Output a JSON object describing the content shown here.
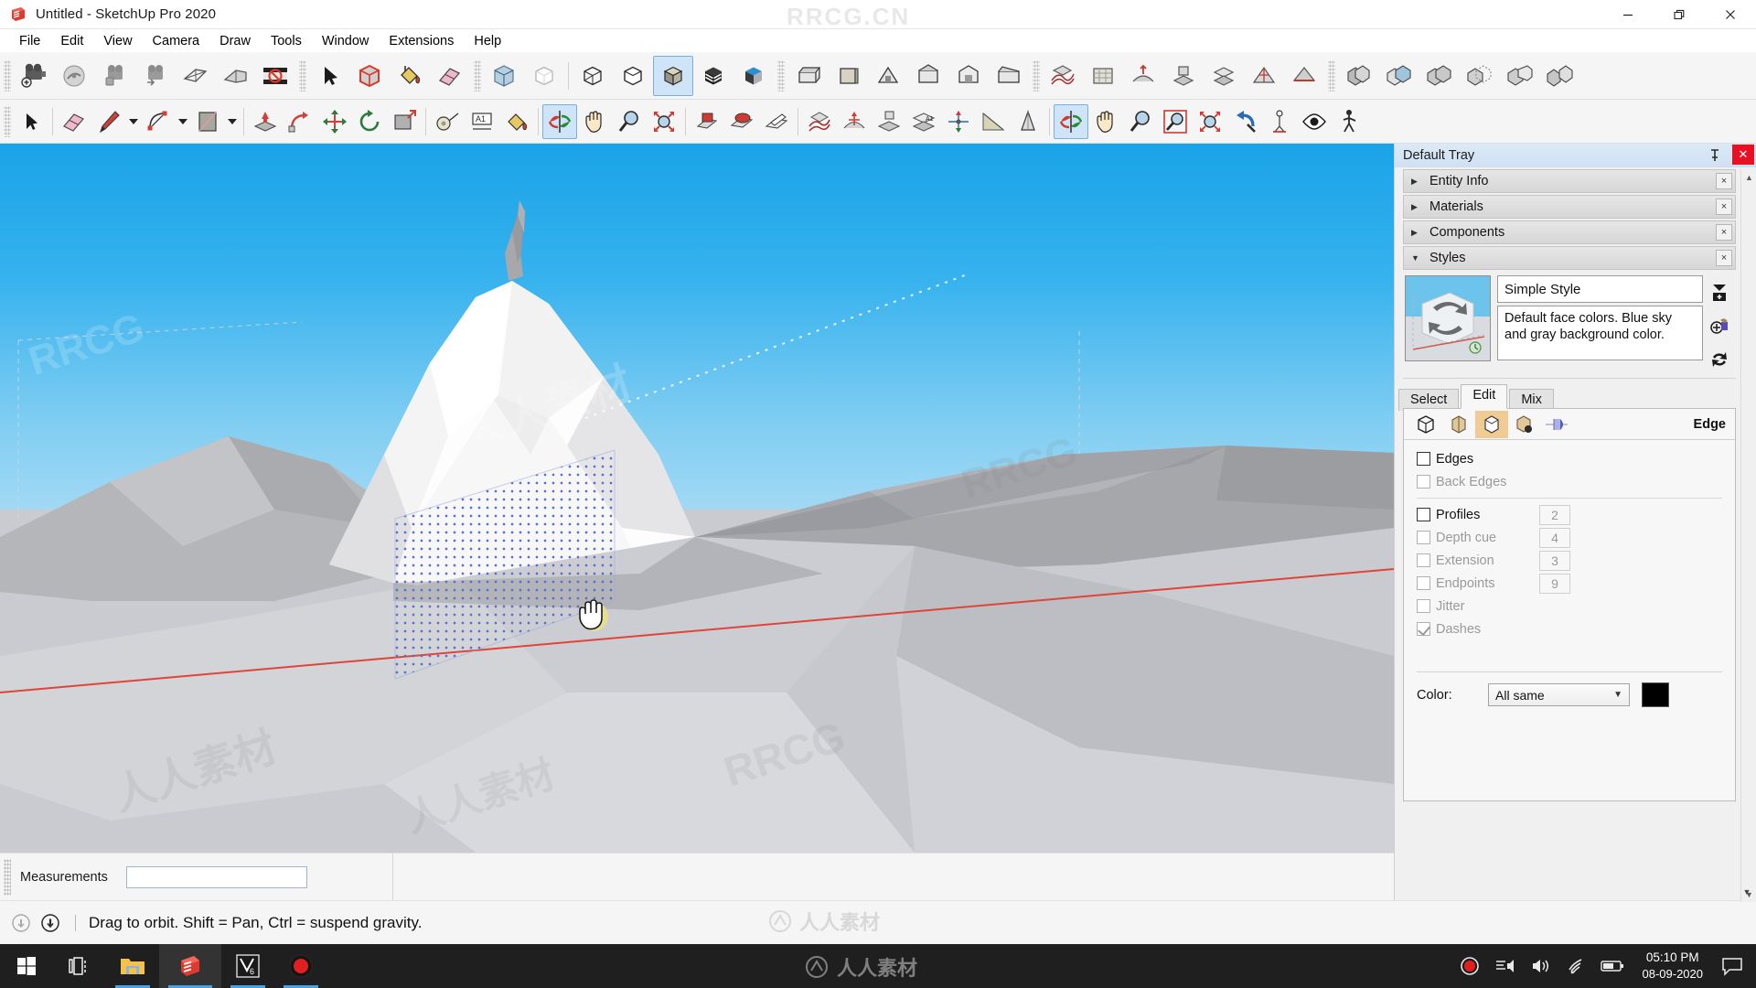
{
  "window": {
    "title": "Untitled - SketchUp Pro 2020",
    "app_icon": "sketchup-icon",
    "watermark": "RRCG.CN",
    "minimize_label": "—",
    "restore_label": "❐",
    "close_label": "✕"
  },
  "menubar": {
    "items": [
      {
        "label": "File"
      },
      {
        "label": "Edit"
      },
      {
        "label": "View"
      },
      {
        "label": "Camera"
      },
      {
        "label": "Draw"
      },
      {
        "label": "Tools"
      },
      {
        "label": "Window"
      },
      {
        "label": "Extensions"
      },
      {
        "label": "Help"
      }
    ]
  },
  "toolbar_row1": {
    "groups": [
      {
        "name": "scenes",
        "buttons": [
          {
            "icon": "add-scene-icon",
            "label": "Add Scene",
            "active": false
          },
          {
            "icon": "update-scene-icon",
            "label": "Update Scene",
            "active": false
          },
          {
            "icon": "previous-scene-icon",
            "label": "Previous Scene",
            "active": false
          },
          {
            "icon": "next-scene-icon",
            "label": "Next Scene",
            "active": false
          },
          {
            "icon": "section-plane-icon",
            "label": "Section Plane",
            "active": false
          },
          {
            "icon": "display-section-cuts-icon",
            "label": "Display Section Cuts",
            "active": false
          },
          {
            "icon": "display-section-planes-icon",
            "label": "Display Section Planes",
            "active": false
          }
        ]
      },
      {
        "name": "principal",
        "buttons": [
          {
            "icon": "select-arrow-icon",
            "label": "Select",
            "active": false
          },
          {
            "icon": "make-component-icon",
            "label": "Make Component",
            "active": false
          },
          {
            "icon": "paint-bucket-icon",
            "label": "Paint Bucket",
            "active": false
          },
          {
            "icon": "eraser-icon",
            "label": "Eraser",
            "active": false
          }
        ]
      },
      {
        "name": "face-styles",
        "buttons": [
          {
            "icon": "xray-icon",
            "label": "X-Ray",
            "active": false
          },
          {
            "icon": "back-edges-icon",
            "label": "Back Edges",
            "active": false
          },
          {
            "icon": "wireframe-icon",
            "label": "Wireframe",
            "active": false
          },
          {
            "icon": "hidden-line-icon",
            "label": "Hidden Line",
            "active": false
          },
          {
            "icon": "shaded-icon",
            "label": "Shaded",
            "active": true
          },
          {
            "icon": "shaded-texture-icon",
            "label": "Shaded With Textures",
            "active": false
          },
          {
            "icon": "monochrome-icon",
            "label": "Monochrome",
            "active": false
          }
        ]
      },
      {
        "name": "standard-views",
        "buttons": [
          {
            "icon": "iso-view-icon",
            "label": "Iso",
            "active": false
          },
          {
            "icon": "top-view-icon",
            "label": "Top",
            "active": false
          },
          {
            "icon": "front-view-icon",
            "label": "Front",
            "active": false
          },
          {
            "icon": "right-view-icon",
            "label": "Right",
            "active": false
          },
          {
            "icon": "back-view-icon",
            "label": "Back",
            "active": false
          },
          {
            "icon": "left-view-icon",
            "label": "Left",
            "active": false
          }
        ]
      },
      {
        "name": "sandbox",
        "buttons": [
          {
            "icon": "from-contours-icon",
            "label": "From Contours",
            "active": false
          },
          {
            "icon": "from-scratch-icon",
            "label": "From Scratch",
            "active": false
          },
          {
            "icon": "smoove-icon",
            "label": "Smoove",
            "active": false
          },
          {
            "icon": "stamp-icon",
            "label": "Stamp",
            "active": false
          },
          {
            "icon": "drape-icon",
            "label": "Drape",
            "active": false
          },
          {
            "icon": "add-detail-icon",
            "label": "Add Detail",
            "active": false
          },
          {
            "icon": "flip-edge-icon",
            "label": "Flip Edge",
            "active": false
          }
        ]
      },
      {
        "name": "solid-tools",
        "buttons": [
          {
            "icon": "outer-shell-icon",
            "label": "Outer Shell",
            "active": false
          },
          {
            "icon": "intersect-icon",
            "label": "Intersect",
            "active": false
          },
          {
            "icon": "union-icon",
            "label": "Union",
            "active": false
          },
          {
            "icon": "subtract-icon",
            "label": "Subtract",
            "active": false
          },
          {
            "icon": "trim-icon",
            "label": "Trim",
            "active": false
          },
          {
            "icon": "split-icon",
            "label": "Split",
            "active": false
          }
        ]
      }
    ]
  },
  "toolbar_row2": {
    "groups": [
      {
        "name": "select",
        "buttons": [
          {
            "icon": "select-arrow-icon",
            "label": "Select",
            "active": false
          }
        ]
      },
      {
        "name": "drawing",
        "buttons": [
          {
            "icon": "eraser-icon",
            "label": "Eraser",
            "active": false
          },
          {
            "icon": "line-pencil-icon",
            "label": "Line",
            "active": false,
            "caret": true
          },
          {
            "icon": "arc-icon",
            "label": "Arc",
            "active": false,
            "caret": true
          },
          {
            "icon": "rectangle-icon",
            "label": "Rectangle",
            "active": false,
            "caret": true
          }
        ]
      },
      {
        "name": "modification",
        "buttons": [
          {
            "icon": "push-pull-icon",
            "label": "Push/Pull",
            "active": false
          },
          {
            "icon": "follow-me-icon",
            "label": "Follow Me",
            "active": false
          },
          {
            "icon": "move-icon",
            "label": "Move",
            "active": false
          },
          {
            "icon": "rotate-icon",
            "label": "Rotate",
            "active": false
          },
          {
            "icon": "scale-icon",
            "label": "Scale",
            "active": false
          }
        ]
      },
      {
        "name": "construction",
        "buttons": [
          {
            "icon": "tape-measure-icon",
            "label": "Tape Measure",
            "active": false
          },
          {
            "icon": "dimension-icon",
            "label": "Dimension",
            "active": false
          },
          {
            "icon": "paint-bucket-icon",
            "label": "Paint Bucket",
            "active": false
          }
        ]
      },
      {
        "name": "camera",
        "buttons": [
          {
            "icon": "orbit-icon",
            "label": "Orbit",
            "active": true
          },
          {
            "icon": "pan-hand-icon",
            "label": "Pan",
            "active": false
          },
          {
            "icon": "zoom-icon",
            "label": "Zoom",
            "active": false
          },
          {
            "icon": "zoom-extents-icon",
            "label": "Zoom Extents",
            "active": false
          }
        ]
      },
      {
        "name": "section",
        "buttons": [
          {
            "icon": "display-section-planes-icon",
            "label": "Display Section Planes",
            "active": false
          },
          {
            "icon": "display-section-cuts-icon",
            "label": "Display Section Cuts",
            "active": false
          },
          {
            "icon": "section-fill-icon",
            "label": "Section Fill",
            "active": false
          }
        ]
      },
      {
        "name": "sandbox2",
        "buttons": [
          {
            "icon": "from-contours-icon",
            "label": "From Contours",
            "active": false
          },
          {
            "icon": "smoove-icon",
            "label": "Smoove",
            "active": false
          },
          {
            "icon": "stamp-icon",
            "label": "Stamp",
            "active": false
          },
          {
            "icon": "drape-icon",
            "label": "Drape",
            "active": false
          },
          {
            "icon": "add-detail-icon",
            "label": "Add Detail",
            "active": false
          },
          {
            "icon": "flip-edge-icon",
            "label": "Flip Edge",
            "active": false
          },
          {
            "icon": "protractor-icon",
            "label": "Protractor",
            "active": false
          }
        ]
      },
      {
        "name": "walkthrough",
        "buttons": [
          {
            "icon": "orbit-icon",
            "label": "Orbit",
            "active": true
          },
          {
            "icon": "pan-hand-icon",
            "label": "Pan",
            "active": false
          },
          {
            "icon": "zoom-icon",
            "label": "Zoom",
            "active": false
          },
          {
            "icon": "zoom-window-icon",
            "label": "Zoom Window",
            "active": false
          },
          {
            "icon": "zoom-extents-icon",
            "label": "Zoom Extents",
            "active": false
          },
          {
            "icon": "previous-view-icon",
            "label": "Previous View",
            "active": false
          },
          {
            "icon": "position-camera-icon",
            "label": "Position Camera",
            "active": false
          },
          {
            "icon": "look-around-icon",
            "label": "Look Around",
            "active": false
          },
          {
            "icon": "walk-icon",
            "label": "Walk",
            "active": false
          }
        ]
      }
    ]
  },
  "viewport": {
    "watermarks": [
      "人人素材",
      "RRCG",
      "人人素材",
      "RRCG",
      "RRCG"
    ],
    "cursor": "pan-hand-cursor",
    "selection": "dotted-grid-selection"
  },
  "measurements": {
    "label": "Measurements",
    "value": "",
    "placeholder": ""
  },
  "statusbar": {
    "left_icon": "info-circle-icon",
    "second_icon": "info-badge-icon",
    "text": "Drag to orbit. Shift = Pan, Ctrl = suspend gravity.",
    "watermark": "人人素材"
  },
  "tray": {
    "title": "Default Tray",
    "pin_icon": "pin-icon",
    "close_label": "✕",
    "panels": [
      {
        "name": "Entity Info",
        "expanded": false,
        "close_label": "×"
      },
      {
        "name": "Materials",
        "expanded": false,
        "close_label": "×"
      },
      {
        "name": "Components",
        "expanded": false,
        "close_label": "×"
      },
      {
        "name": "Styles",
        "expanded": true,
        "close_label": "×"
      }
    ],
    "styles": {
      "style_name": "Simple Style",
      "style_description": "Default face colors. Blue sky and gray background color.",
      "thumbnail": "style-preview-thumbnail",
      "side_buttons": [
        {
          "icon": "create-style-icon",
          "label": "Create new Style"
        },
        {
          "icon": "update-style-icon",
          "label": "Update Style with changes"
        },
        {
          "icon": "refresh-style-icon",
          "label": "Refresh"
        }
      ],
      "tabs": [
        {
          "label": "Select",
          "active": false
        },
        {
          "label": "Edit",
          "active": true
        },
        {
          "label": "Mix",
          "active": false
        }
      ],
      "edit": {
        "category_label": "Edge",
        "categories": [
          {
            "icon": "edge-settings-icon",
            "label": "Edge Settings",
            "active": false
          },
          {
            "icon": "face-settings-icon",
            "label": "Face Settings",
            "active": false
          },
          {
            "icon": "background-settings-icon",
            "label": "Background Settings",
            "active": true
          },
          {
            "icon": "watermark-settings-icon",
            "label": "Watermark Settings",
            "active": false
          },
          {
            "icon": "modeling-settings-icon",
            "label": "Modeling Settings",
            "active": false
          }
        ],
        "options": [
          {
            "label": "Edges",
            "checked": false,
            "enabled": true,
            "value": null
          },
          {
            "label": "Back Edges",
            "checked": false,
            "enabled": false,
            "value": null
          },
          {
            "label": "Profiles",
            "checked": false,
            "enabled": true,
            "value": "2"
          },
          {
            "label": "Depth cue",
            "checked": false,
            "enabled": false,
            "value": "4"
          },
          {
            "label": "Extension",
            "checked": false,
            "enabled": false,
            "value": "3"
          },
          {
            "label": "Endpoints",
            "checked": false,
            "enabled": false,
            "value": "9"
          },
          {
            "label": "Jitter",
            "checked": false,
            "enabled": false,
            "value": null
          },
          {
            "label": "Dashes",
            "checked": true,
            "enabled": false,
            "value": null
          }
        ],
        "color": {
          "label": "Color:",
          "selected": "All same",
          "swatch_hex": "#000000",
          "caret_icon": "chevron-down-icon"
        }
      }
    }
  },
  "taskbar": {
    "buttons": [
      {
        "icon": "windows-start-icon",
        "label": "Start",
        "state": "none"
      },
      {
        "icon": "task-view-icon",
        "label": "Task View",
        "state": "none"
      },
      {
        "icon": "file-explorer-icon",
        "label": "File Explorer",
        "state": "open"
      },
      {
        "icon": "sketchup-icon",
        "label": "SketchUp Pro 2020",
        "state": "current"
      },
      {
        "icon": "vegas-icon",
        "label": "VEGAS Pro",
        "state": "open"
      },
      {
        "icon": "recorder-icon",
        "label": "Screen Recorder",
        "state": "open"
      }
    ],
    "watermark": "人人素材",
    "systray": [
      {
        "icon": "record-dot-icon",
        "label": "Recording"
      },
      {
        "icon": "volume-mixer-icon",
        "label": "Volume Mixer"
      },
      {
        "icon": "speaker-icon",
        "label": "Speakers"
      },
      {
        "icon": "wifi-icon",
        "label": "Network"
      },
      {
        "icon": "battery-icon",
        "label": "Battery"
      }
    ],
    "clock": {
      "time": "05:10 PM",
      "date": "08-09-2020"
    },
    "action_center_icon": "action-center-icon"
  },
  "colors": {
    "accent": "#4aa3e0",
    "tray_title_bg": "#cfe0f2",
    "active_tool_bg": "#cfe4f7",
    "close_red": "#e81123",
    "sky_top": "#1aa3e8",
    "ground": "#c9cbd0",
    "axis_red": "#e0453a",
    "selection_blue": "#5a6fd0",
    "category_active": "#f0cb94"
  }
}
